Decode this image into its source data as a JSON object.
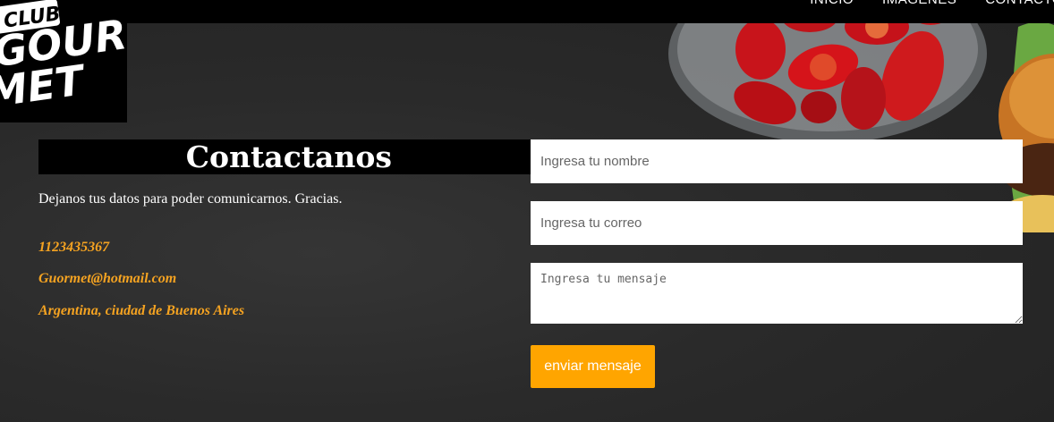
{
  "nav": {
    "items": [
      "INICIO",
      "IMÁGENES",
      "CONTACTO"
    ]
  },
  "logo": {
    "line1": "CLUB",
    "line2": "GOUR",
    "line3": "MET"
  },
  "contact": {
    "title": "Contactanos",
    "intro": "Dejanos tus datos para poder comunicarnos. Gracias.",
    "phone": "1123435367",
    "email": "Guormet@hotmail.com",
    "location": "Argentina, ciudad de Buenos Aires"
  },
  "form": {
    "name_placeholder": "Ingresa tu nombre",
    "email_placeholder": "Ingresa tu correo",
    "message_placeholder": "Ingresa tu mensaje",
    "submit_label": "enviar mensaje"
  },
  "colors": {
    "accent": "#ffa500",
    "info_text": "#f5a321",
    "background": "#2b2b2b"
  }
}
